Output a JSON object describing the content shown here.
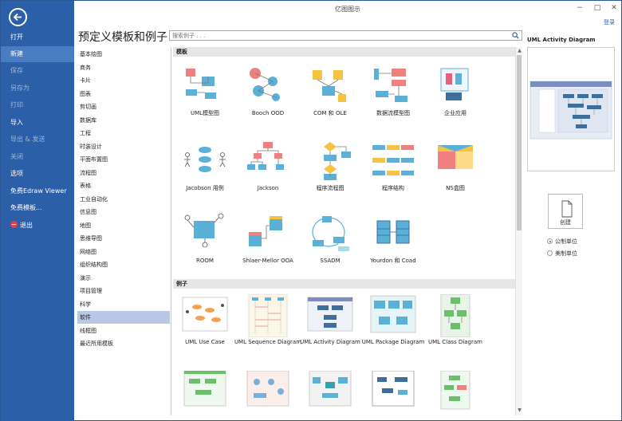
{
  "window": {
    "title": "亿图图示",
    "login_label": "登录",
    "minimize": "−",
    "maximize": "□",
    "close": "✕"
  },
  "nav": {
    "items": [
      {
        "label": "打开",
        "state": "normal"
      },
      {
        "label": "新建",
        "state": "active"
      },
      {
        "label": "保存",
        "state": "dim"
      },
      {
        "label": "另存为",
        "state": "dim"
      },
      {
        "label": "打印",
        "state": "dim"
      },
      {
        "label": "导入",
        "state": "normal"
      },
      {
        "label": "导出 & 发送",
        "state": "dim"
      },
      {
        "label": "关闭",
        "state": "dim"
      },
      {
        "label": "选项",
        "state": "normal"
      },
      {
        "label": "免费Edraw Viewer",
        "state": "normal"
      },
      {
        "label": "免费模板...",
        "state": "normal"
      },
      {
        "label": "退出",
        "state": "normal"
      }
    ]
  },
  "header": {
    "title": "预定义模板和例子"
  },
  "search": {
    "placeholder": "搜索例子 . . ."
  },
  "categories": [
    "基本绘图",
    "商务",
    "卡片",
    "图表",
    "剪切画",
    "数据库",
    "工程",
    "时装设计",
    "平面布置图",
    "流程图",
    "表格",
    "工业自动化",
    "信息图",
    "地图",
    "思维导图",
    "网络图",
    "组织结构图",
    "演示",
    "项目管理",
    "科学",
    "软件",
    "线框图",
    "最近所用模板"
  ],
  "selected_category": "软件",
  "sections": {
    "templates": "模板",
    "examples": "例子"
  },
  "templates": [
    "UML模型图",
    "Booch OOD",
    "COM 和 OLE",
    "数据流模型图",
    "企业应用",
    "Jacobson 用例",
    "Jackson",
    "程序流程图",
    "程序结构",
    "NS盒图",
    "ROOM",
    "Shlaer-Mellor OOA",
    "SSADM",
    "Yourdon 和 Coad"
  ],
  "examples": [
    "UML Use Case",
    "UML Sequence Diagram",
    "UML Activity Diagram",
    "UML Package Diagram",
    "UML Class Diagram",
    "",
    "",
    "",
    "",
    ""
  ],
  "preview": {
    "title": "UML Activity Diagram",
    "create_label": "创建"
  },
  "units": [
    {
      "label": "公制单位",
      "checked": true
    },
    {
      "label": "美制单位",
      "checked": false
    }
  ],
  "colors": {
    "nav_bg": "#2b5fa8",
    "nav_active": "#4a7cc2",
    "accent_blue": "#2b5fa8",
    "selected_category": "#b8c8e4"
  }
}
